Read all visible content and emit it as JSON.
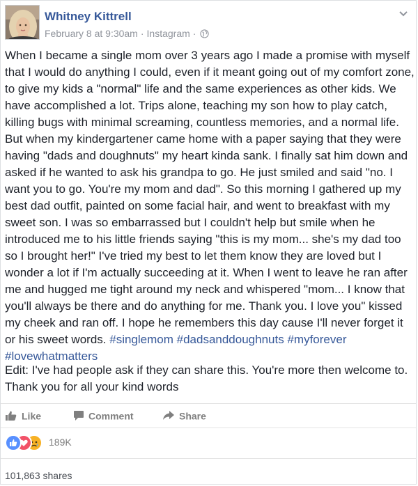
{
  "post": {
    "author": "Whitney Kittrell",
    "date": "February 8 at 9:30am",
    "separator": "·",
    "source": "Instagram",
    "body_text": "When I became a single mom over 3 years ago I made a promise with myself that I would do anything I could, even if it meant going out of my comfort zone, to give my kids a \"normal\" life and the same experiences as other kids. We have accomplished a lot. Trips alone, teaching my son how to play catch, killing bugs with minimal screaming, countless memories, and a normal life. But when my kindergartener came home with a paper saying that they were having \"dads and doughnuts\" my heart kinda sank. I finally sat him down and asked if he wanted to ask his grandpa to go. He just smiled and said \"no. I want you to go. You're my mom and dad\". So this morning I gathered up my best dad outfit, painted on some facial hair, and went to breakfast with my sweet son. I was so embarrassed but I couldn't help but smile when he introduced me to his little friends saying \"this is my mom... she's my dad too so I brought her!\" I've tried my best to let them know they are loved but I wonder a lot if I'm actually succeeding at it. When I went to leave he ran after me and hugged me tight around my neck and whispered \"mom... I know that you'll always be there and do anything for me. Thank you. I love you\" kissed my cheek and ran off. I hope he remembers this day cause I'll never forget it or his sweet words.",
    "hashtags": [
      "#singlemom",
      "#dadsanddoughnuts",
      "#myforever",
      "#lovewhatmatters"
    ],
    "edit_text": "Edit: I've had people ask if they can share this. You're more then welcome to. Thank you for all your kind words"
  },
  "actions": {
    "like_label": "Like",
    "comment_label": "Comment",
    "share_label": "Share"
  },
  "reactions": {
    "icons": [
      "like-reaction-icon",
      "love-reaction-icon",
      "sad-reaction-icon"
    ],
    "count": "189K"
  },
  "shares": {
    "label": "101,863 shares"
  },
  "colors": {
    "link": "#365899",
    "text": "#1d2129",
    "muted": "#90949c",
    "like_blue": "#5890ff",
    "love_red": "#f25268",
    "sad_yellow": "#f7b125"
  }
}
